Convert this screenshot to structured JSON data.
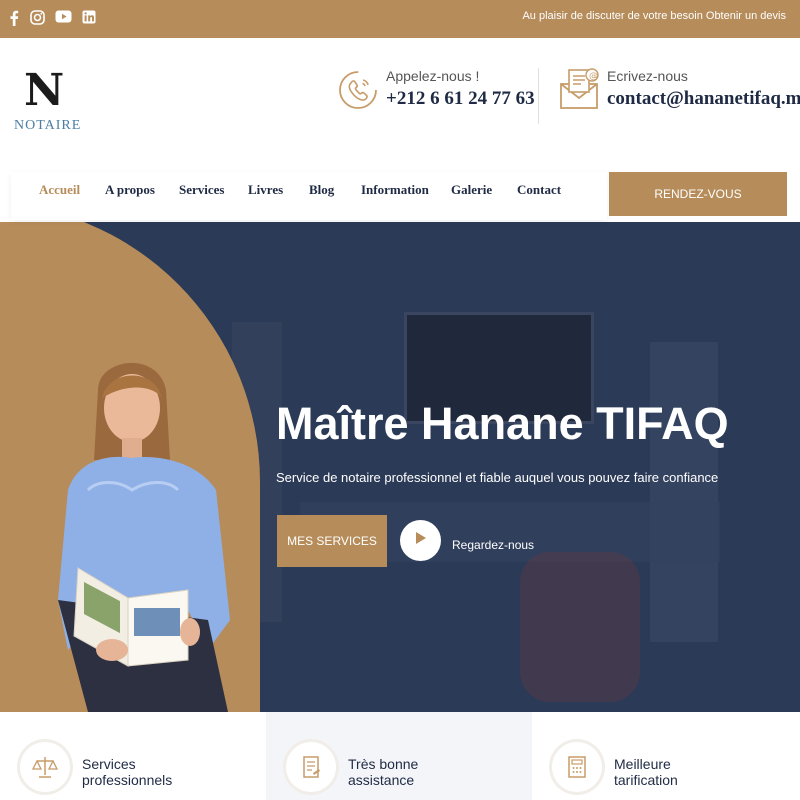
{
  "topbar": {
    "social": [
      "facebook-icon",
      "instagram-icon",
      "youtube-icon",
      "linkedin-icon"
    ],
    "message": "Au plaisir de discuter de votre besoin Obtenir un devis"
  },
  "brand": {
    "logo_letter": "N",
    "logo_text": "NOTAIRE"
  },
  "contact": {
    "phone_label": "Appelez-nous !",
    "phone_value": "+212 6 61 24 77 63",
    "email_label": "Ecrivez-nous",
    "email_value": "contact@hananetifaq.ma"
  },
  "nav": {
    "items": [
      "Accueil",
      "A propos",
      "Services",
      "Livres",
      "Blog",
      "Information",
      "Galerie",
      "Contact"
    ],
    "cta": "RENDEZ-VOUS"
  },
  "hero": {
    "title": "Maître Hanane TIFAQ",
    "subtitle": "Service de notaire professionnel et fiable auquel vous pouvez faire confiance",
    "primary_button": "MES SERVICES",
    "watch_label": "Regardez-nous"
  },
  "features": [
    {
      "label": "Services professionnels",
      "icon": "scales-icon"
    },
    {
      "label": "Très bonne assistance",
      "icon": "document-icon"
    },
    {
      "label": "Meilleure tarification",
      "icon": "calculator-icon"
    }
  ],
  "colors": {
    "accent": "#b68c5a",
    "navy": "#2b3a57",
    "text": "#1f2a44"
  }
}
